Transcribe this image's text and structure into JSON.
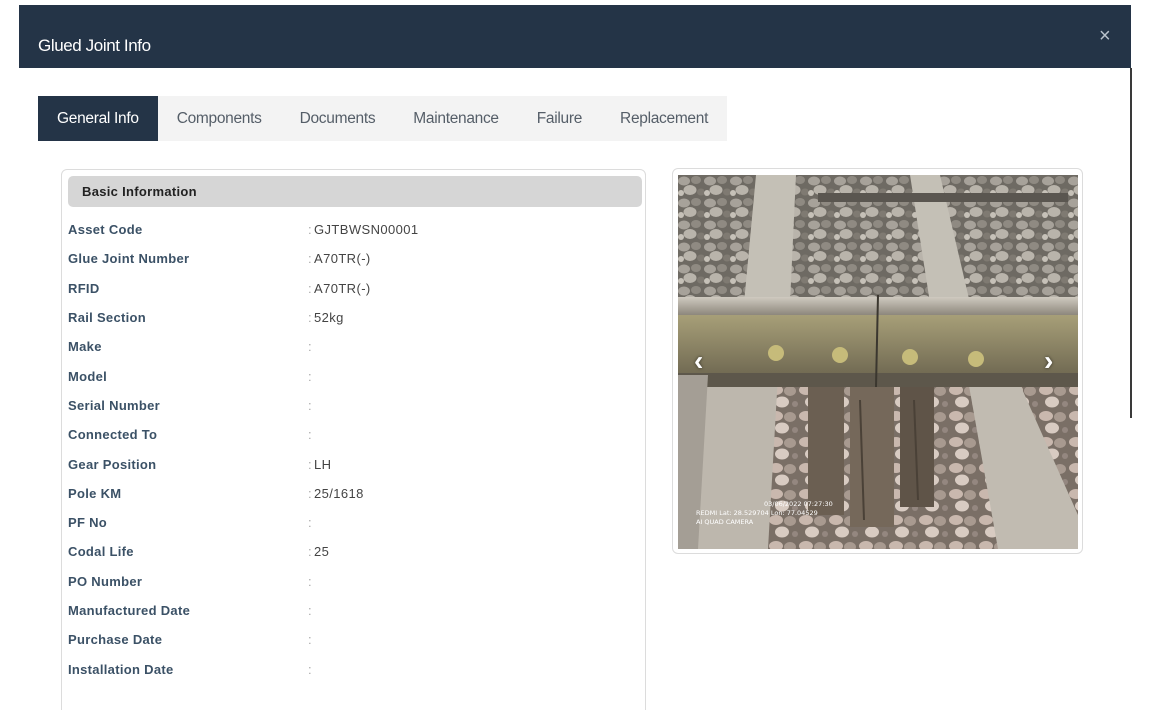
{
  "dialog": {
    "title": "Glued Joint Info",
    "close_icon": "close-icon",
    "close_glyph": "×"
  },
  "tabs": [
    {
      "label": "General Info",
      "active": true
    },
    {
      "label": "Components",
      "active": false
    },
    {
      "label": "Documents",
      "active": false
    },
    {
      "label": "Maintenance",
      "active": false
    },
    {
      "label": "Failure",
      "active": false
    },
    {
      "label": "Replacement",
      "active": false
    }
  ],
  "basic_info": {
    "section_title": "Basic Information",
    "rows": [
      {
        "label": "Asset Code",
        "value": "GJTBWSN00001"
      },
      {
        "label": "Glue Joint Number",
        "value": "A70TR(-)"
      },
      {
        "label": "RFID",
        "value": "A70TR(-)"
      },
      {
        "label": "Rail Section",
        "value": "52kg"
      },
      {
        "label": "Make",
        "value": ""
      },
      {
        "label": "Model",
        "value": ""
      },
      {
        "label": "Serial Number",
        "value": ""
      },
      {
        "label": "Connected To",
        "value": ""
      },
      {
        "label": "Gear Position",
        "value": "LH"
      },
      {
        "label": "Pole KM",
        "value": "25/1618"
      },
      {
        "label": "PF No",
        "value": ""
      },
      {
        "label": "Codal Life",
        "value": "25"
      },
      {
        "label": "PO Number",
        "value": ""
      },
      {
        "label": "Manufactured Date",
        "value": ""
      },
      {
        "label": "Purchase Date",
        "value": ""
      },
      {
        "label": "Installation Date",
        "value": ""
      }
    ]
  },
  "photo": {
    "prev_glyph": "‹",
    "next_glyph": "›",
    "overlay_datetime": "03/06/2022 07:27:30",
    "overlay_coords": "REDMI   Lat: 28.529704 Lon: 77.04529",
    "overlay_camera": "AI QUAD CAMERA"
  },
  "colors": {
    "header_bg": "#243447",
    "active_tab_bg": "#243447",
    "tab_bg": "#f3f3f3",
    "section_head_bg": "#d6d6d6",
    "label_color": "#3b5166"
  }
}
